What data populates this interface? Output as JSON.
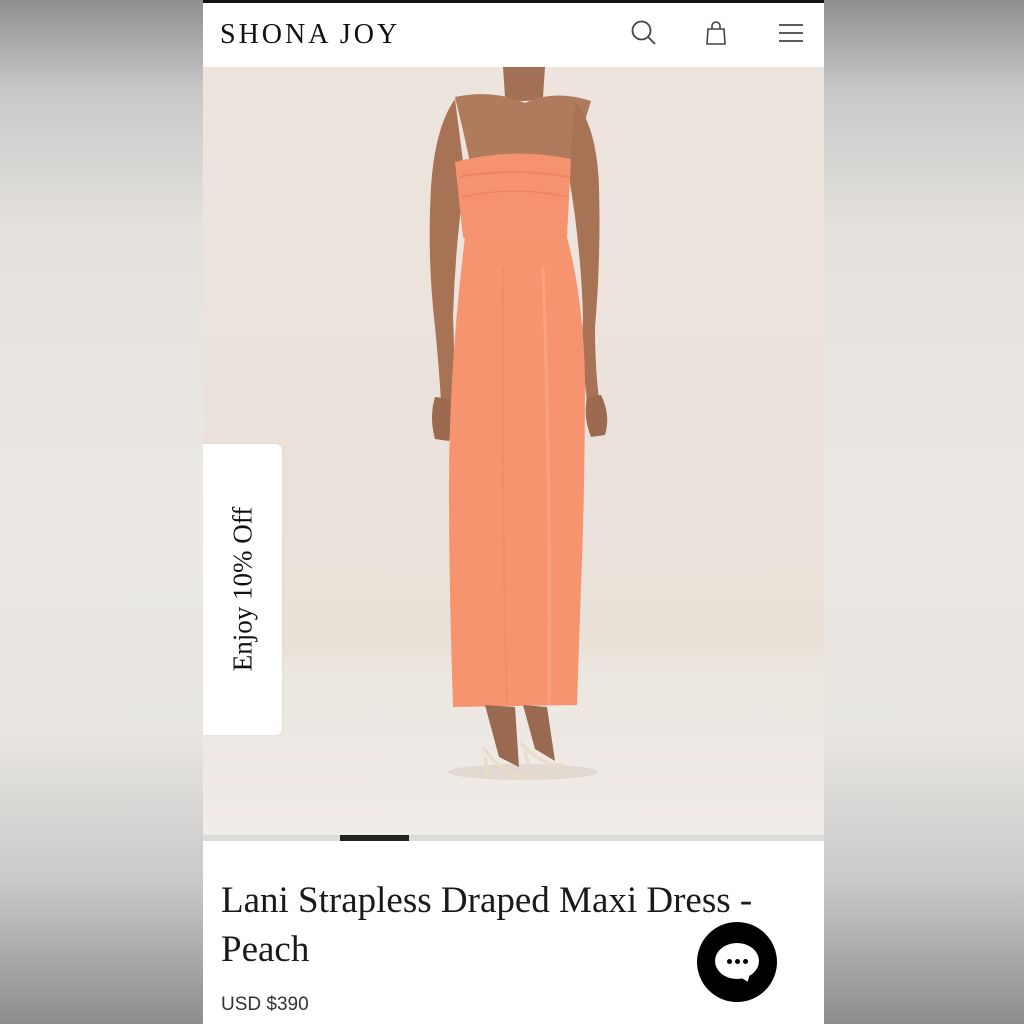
{
  "header": {
    "logo": "SHONA JOY",
    "icons": [
      "search-icon",
      "bag-icon",
      "menu-icon"
    ]
  },
  "promo": {
    "label": "Enjoy 10% Off"
  },
  "carousel": {
    "active_index": 2,
    "total": 9
  },
  "product": {
    "title": "Lani Strapless Draped Maxi Dress - Peach",
    "price": "USD $390"
  },
  "chat": {
    "icon": "chat-bubble-icon"
  },
  "colors": {
    "dress": "#F4926D",
    "backdrop": "#EDE4DD",
    "ink": "#111111"
  }
}
